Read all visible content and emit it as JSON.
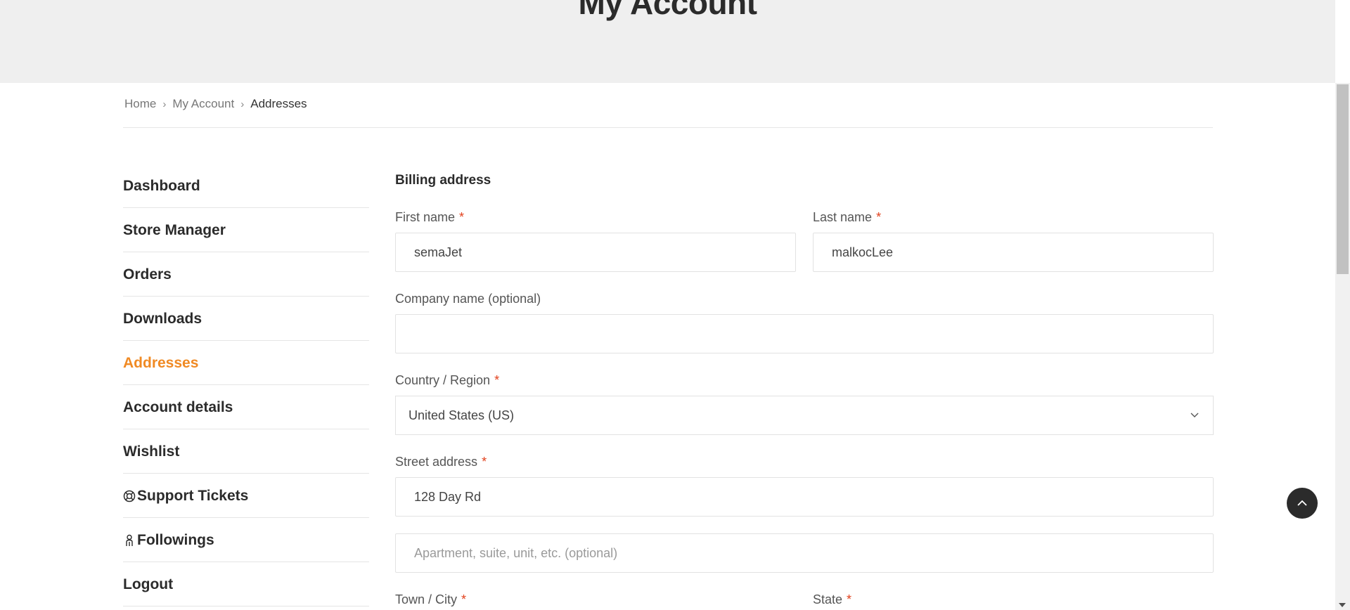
{
  "header": {
    "title": "My Account"
  },
  "breadcrumb": {
    "items": [
      "Home",
      "My Account",
      "Addresses"
    ]
  },
  "sidebar": {
    "items": [
      {
        "label": "Dashboard"
      },
      {
        "label": "Store Manager"
      },
      {
        "label": "Orders"
      },
      {
        "label": "Downloads"
      },
      {
        "label": "Addresses",
        "active": true
      },
      {
        "label": "Account details"
      },
      {
        "label": "Wishlist"
      },
      {
        "label": "Support Tickets",
        "icon": "lifebuoy-icon"
      },
      {
        "label": "Followings",
        "icon": "user-follow-icon"
      },
      {
        "label": "Logout"
      }
    ]
  },
  "form": {
    "title": "Billing address",
    "first_name": {
      "label": "First name",
      "value": "semaJet"
    },
    "last_name": {
      "label": "Last name",
      "value": "malkocLee"
    },
    "company": {
      "label": "Company name (optional)",
      "value": ""
    },
    "country": {
      "label": "Country / Region",
      "value": "United States (US)"
    },
    "street": {
      "label": "Street address",
      "value": "128 Day Rd"
    },
    "apartment": {
      "placeholder": "Apartment, suite, unit, etc. (optional)",
      "value": ""
    },
    "town": {
      "label": "Town / City"
    },
    "state": {
      "label": "State"
    },
    "required_mark": "*"
  },
  "colors": {
    "accent": "#f08a24",
    "required": "#e2401c",
    "text": "#2b2b2b"
  }
}
